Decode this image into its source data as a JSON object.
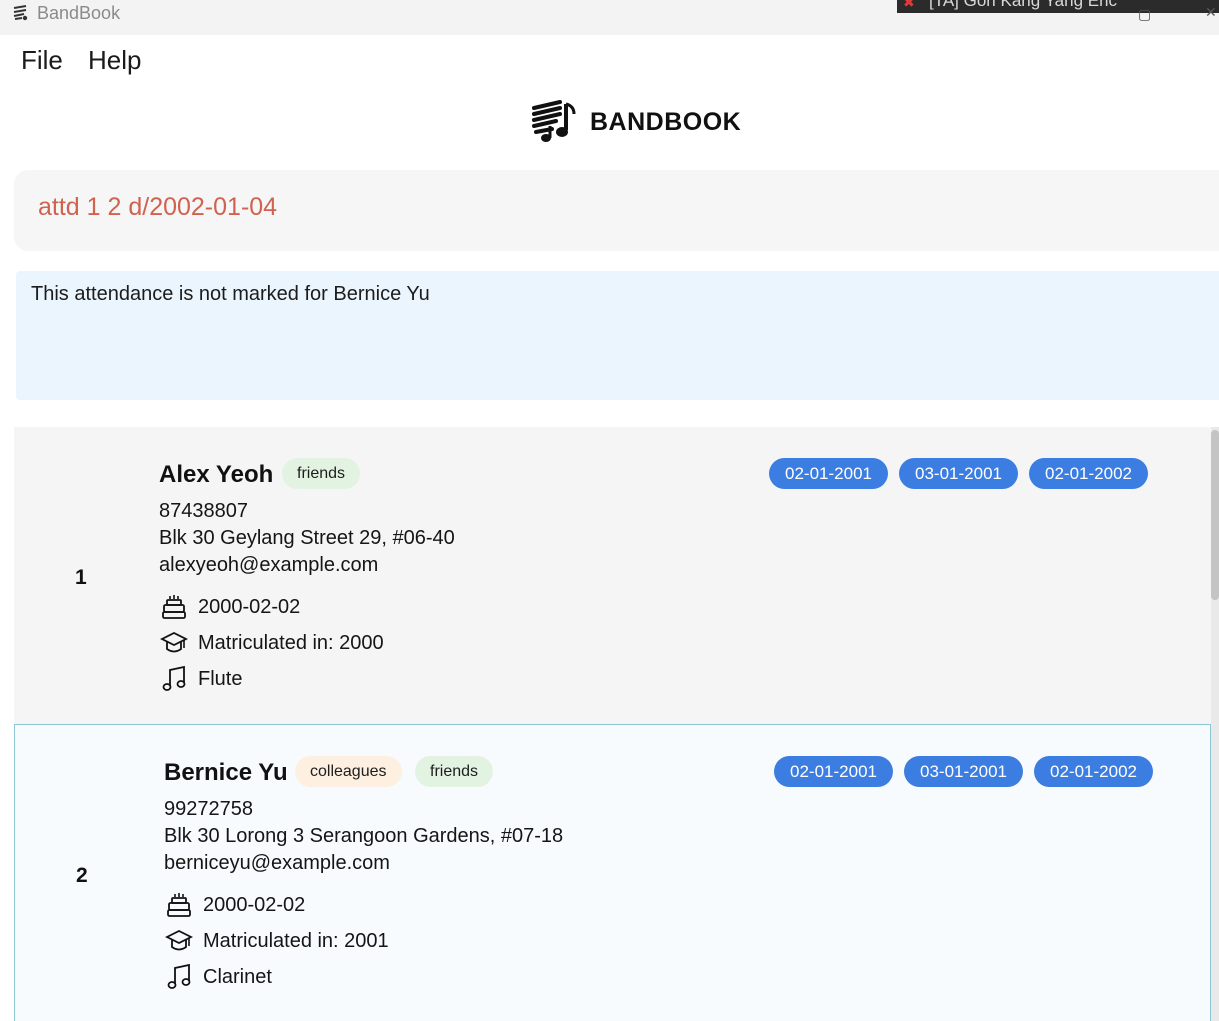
{
  "window": {
    "title": "BandBook",
    "overlay_text": "[TA] Goh Kang Yang Eric",
    "overlay_icon": "muted-mic-icon",
    "minimize": "—",
    "close": "✕"
  },
  "menu": {
    "file": "File",
    "help": "Help"
  },
  "logo": {
    "text": "BANDBOOK",
    "icon": "music-book-icon"
  },
  "command": {
    "value": "attd 1 2 d/2002-01-04",
    "color": "#d0624f"
  },
  "result": {
    "message": "This attendance is not marked for Bernice Yu"
  },
  "colors": {
    "accent": "#3b7de0",
    "tag_friends": "#e3f3e2",
    "tag_colleagues": "#fdf0e1"
  },
  "persons": [
    {
      "index": "1",
      "name": "Alex Yeoh",
      "tags": [
        "friends"
      ],
      "attendance": [
        "02-01-2001",
        "03-01-2001",
        "02-01-2002"
      ],
      "phone": "87438807",
      "address": "Blk 30 Geylang Street 29, #06-40",
      "email": "alexyeoh@example.com",
      "birthday": "2000-02-02",
      "matriculation": "Matriculated in: 2000",
      "instrument": "Flute"
    },
    {
      "index": "2",
      "name": "Bernice Yu",
      "tags": [
        "colleagues",
        "friends"
      ],
      "attendance": [
        "02-01-2001",
        "03-01-2001",
        "02-01-2002"
      ],
      "phone": "99272758",
      "address": "Blk 30 Lorong 3 Serangoon Gardens, #07-18",
      "email": "berniceyu@example.com",
      "birthday": "2000-02-02",
      "matriculation": "Matriculated in: 2001",
      "instrument": "Clarinet"
    }
  ]
}
